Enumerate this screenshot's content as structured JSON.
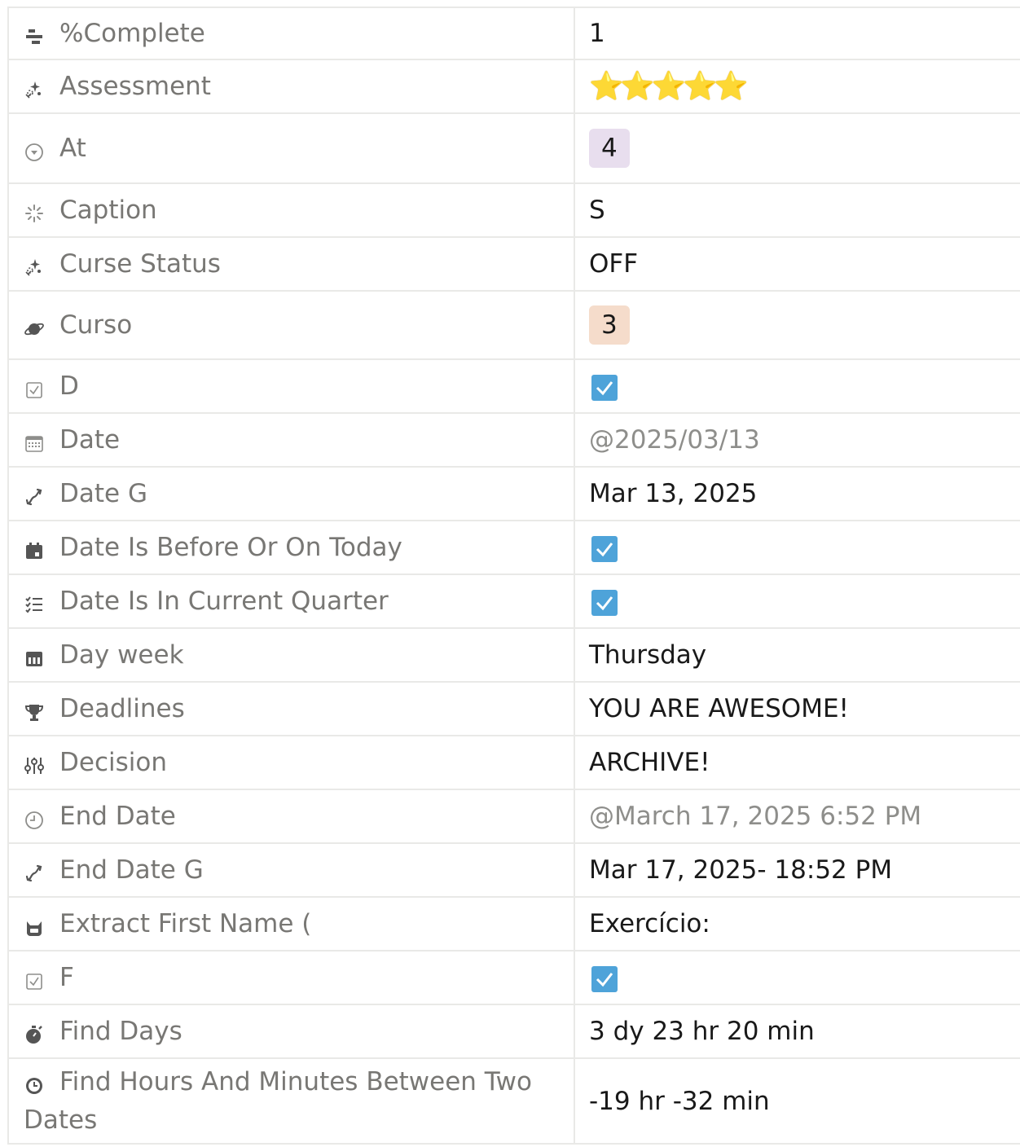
{
  "rows": [
    {
      "name": "%Complete",
      "icon": "horizontal-bars-icon",
      "type": "text",
      "value": "1"
    },
    {
      "name": "Assessment",
      "icon": "sparkle-formula-icon",
      "type": "stars",
      "value": "⭐⭐⭐⭐⭐"
    },
    {
      "name": "At",
      "icon": "circle-chevron-down-icon",
      "type": "chip",
      "value": "4",
      "chip_color": "#e8deee"
    },
    {
      "name": "Caption",
      "icon": "loading-spinner-icon",
      "type": "text",
      "value": "S"
    },
    {
      "name": "Curse Status",
      "icon": "sparkle-formula-icon",
      "type": "text",
      "value": "OFF"
    },
    {
      "name": "Curso",
      "icon": "planet-icon",
      "type": "chip",
      "value": "3",
      "chip_color": "#f5dccb"
    },
    {
      "name": "D",
      "icon": "checkbox-icon",
      "type": "checkbox",
      "value": "checked"
    },
    {
      "name": "Date",
      "icon": "calendar-grid-icon",
      "type": "muted",
      "value": "@2025/03/13"
    },
    {
      "name": "Date G",
      "icon": "arrow-relation-icon",
      "type": "text",
      "value": "Mar 13, 2025"
    },
    {
      "name": "Date Is Before Or On Today",
      "icon": "calendar-solid-icon",
      "type": "checkbox",
      "value": "checked"
    },
    {
      "name": "Date Is In Current Quarter",
      "icon": "checklist-icon",
      "type": "checkbox",
      "value": "checked"
    },
    {
      "name": "Day week",
      "icon": "calendar-week-icon",
      "type": "text",
      "value": "Thursday"
    },
    {
      "name": "Deadlines",
      "icon": "trophy-icon",
      "type": "text",
      "value": "YOU ARE AWESOME!"
    },
    {
      "name": "Decision",
      "icon": "sliders-icon",
      "type": "text",
      "value": "ARCHIVE!"
    },
    {
      "name": "End Date",
      "icon": "clock-outline-icon",
      "type": "muted",
      "value": "@March 17, 2025 6:52 PM"
    },
    {
      "name": "End Date G",
      "icon": "arrow-relation-icon",
      "type": "text",
      "value": "Mar 17, 2025- 18:52 PM"
    },
    {
      "name": "Extract First Name (",
      "icon": "cat-icon",
      "type": "text",
      "value": "Exercício:"
    },
    {
      "name": "F",
      "icon": "checkbox-icon",
      "type": "checkbox",
      "value": "checked"
    },
    {
      "name": "Find Days",
      "icon": "stopwatch-icon",
      "type": "text",
      "value": "3 dy 23 hr 20 min"
    },
    {
      "name": "Find Hours And Minutes Between Two Dates",
      "icon": "clock-solid-icon",
      "type": "text",
      "value": "-19 hr -32 min"
    }
  ],
  "colors": {
    "border": "#e9e9e7",
    "label": "#787774",
    "value": "#191919",
    "muted_value": "#8e8e8b",
    "checkbox": "#4ea3d9"
  }
}
